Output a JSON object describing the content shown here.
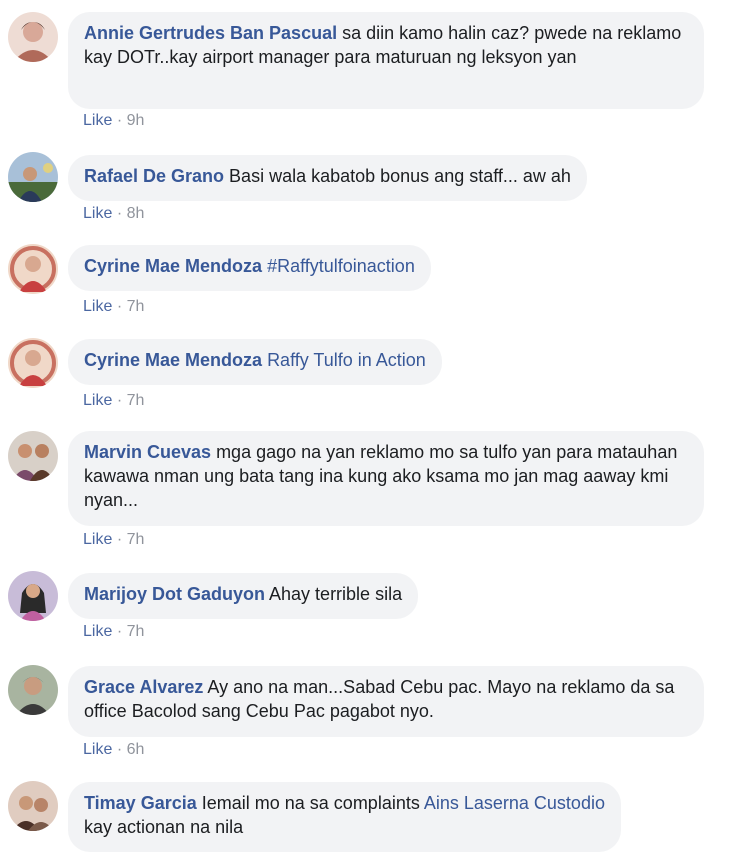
{
  "comments": [
    {
      "author": "Annie Gertrudes Ban Pascual",
      "text": " sa diin kamo halin caz? pwede na reklamo kay DOTr..kay airport manager para maturuan ng leksyon yan",
      "like": "Like",
      "time": "9h",
      "avatar_colors": [
        "#f0d0c8",
        "#b06a5a"
      ]
    },
    {
      "author": "Rafael De Grano",
      "text": " Basi wala kabatob bonus ang staff... aw ah",
      "like": "Like",
      "time": "8h",
      "avatar_colors": [
        "#8aa8c8",
        "#3a5a3a"
      ]
    },
    {
      "author": "Cyrine Mae Mendoza",
      "tag": "#Raffytulfoinaction",
      "like": "Like",
      "time": "7h",
      "avatar_colors": [
        "#e8b8a8",
        "#c84040"
      ]
    },
    {
      "author": "Cyrine Mae Mendoza",
      "tag": "Raffy Tulfo in Action",
      "like": "Like",
      "time": "7h",
      "avatar_colors": [
        "#e8b8a8",
        "#c84040"
      ]
    },
    {
      "author": "Marvin Cuevas",
      "text": " mga gago na yan reklamo mo sa tulfo yan para matauhan kawawa nman ung bata tang ina kung ako ksama mo jan mag aaway kmi nyan...",
      "like": "Like",
      "time": "7h",
      "avatar_colors": [
        "#d8c0b0",
        "#6a4a3a"
      ]
    },
    {
      "author": "Marijoy Dot Gaduyon",
      "text": " Ahay terrible sila",
      "like": "Like",
      "time": "7h",
      "avatar_colors": [
        "#c8b8d8",
        "#2a2a2a"
      ]
    },
    {
      "author": "Grace Alvarez",
      "text": " Ay ano na man...Sabad Cebu pac. Mayo na reklamo da sa office Bacolod sang Cebu Pac pagabot nyo.",
      "like": "Like",
      "time": "6h",
      "avatar_colors": [
        "#9aa890",
        "#3a3a3a"
      ]
    },
    {
      "author": "Timay Garcia",
      "text": " Iemail mo na sa complaints ",
      "mention": "Ains Laserna Custodio",
      "text2": " kay actionan na nila",
      "avatar_colors": [
        "#d0b8a8",
        "#4a3028"
      ]
    }
  ]
}
